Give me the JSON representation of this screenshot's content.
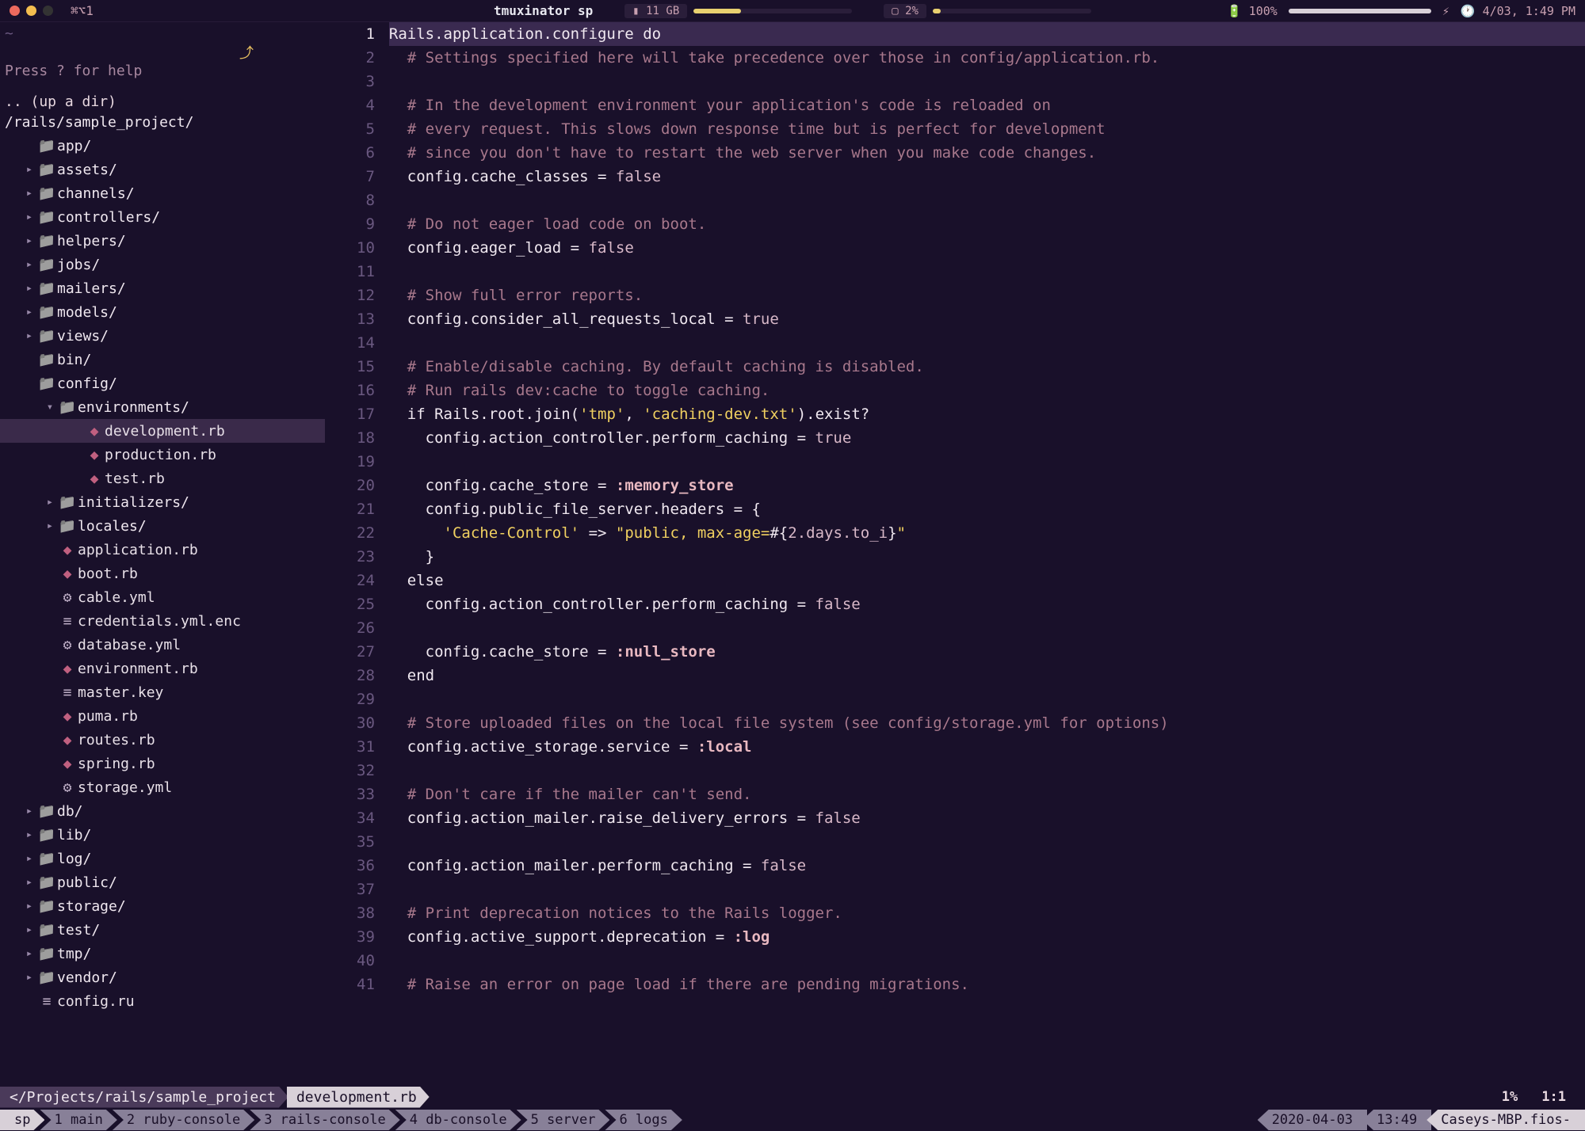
{
  "menubar": {
    "keyboard": "⌘⌥1",
    "title": "tmuxinator sp",
    "ram_label": "11 GB",
    "cpu_label": "2%",
    "battery": "100%",
    "lightning": "⚡",
    "clock_label": "4/03, 1:49 PM"
  },
  "sidebar": {
    "tilde": "~",
    "help": "Press ? for help",
    "updir": ".. (up a dir)",
    "root": "/rails/sample_project/",
    "tree": [
      {
        "indent": 1,
        "type": "folder",
        "arrow": "",
        "label": "app/"
      },
      {
        "indent": 1,
        "type": "folder",
        "arrow": "▸",
        "label": "assets/"
      },
      {
        "indent": 1,
        "type": "folder",
        "arrow": "▸",
        "label": "channels/"
      },
      {
        "indent": 1,
        "type": "folder",
        "arrow": "▸",
        "label": "controllers/"
      },
      {
        "indent": 1,
        "type": "folder",
        "arrow": "▸",
        "label": "helpers/"
      },
      {
        "indent": 1,
        "type": "folder",
        "arrow": "▸",
        "label": "jobs/"
      },
      {
        "indent": 1,
        "type": "folder",
        "arrow": "▸",
        "label": "mailers/"
      },
      {
        "indent": 1,
        "type": "folder",
        "arrow": "▸",
        "label": "models/"
      },
      {
        "indent": 1,
        "type": "folder",
        "arrow": "▸",
        "label": "views/"
      },
      {
        "indent": 1,
        "type": "folder",
        "arrow": "",
        "label": "bin/"
      },
      {
        "indent": 1,
        "type": "folder",
        "arrow": "",
        "label": "config/"
      },
      {
        "indent": 2,
        "type": "folder",
        "arrow": "▾",
        "label": "environments/"
      },
      {
        "indent": 3,
        "type": "ruby",
        "arrow": "",
        "label": "development.rb",
        "active": true
      },
      {
        "indent": 3,
        "type": "ruby",
        "arrow": "",
        "label": "production.rb"
      },
      {
        "indent": 3,
        "type": "ruby",
        "arrow": "",
        "label": "test.rb"
      },
      {
        "indent": 2,
        "type": "folder",
        "arrow": "▸",
        "label": "initializers/"
      },
      {
        "indent": 2,
        "type": "folder",
        "arrow": "▸",
        "label": "locales/"
      },
      {
        "indent": 2,
        "type": "ruby",
        "arrow": "",
        "label": "application.rb"
      },
      {
        "indent": 2,
        "type": "ruby",
        "arrow": "",
        "label": "boot.rb"
      },
      {
        "indent": 2,
        "type": "yml",
        "arrow": "",
        "label": "cable.yml"
      },
      {
        "indent": 2,
        "type": "enc",
        "arrow": "",
        "label": "credentials.yml.enc"
      },
      {
        "indent": 2,
        "type": "yml",
        "arrow": "",
        "label": "database.yml"
      },
      {
        "indent": 2,
        "type": "ruby",
        "arrow": "",
        "label": "environment.rb"
      },
      {
        "indent": 2,
        "type": "key",
        "arrow": "",
        "label": "master.key"
      },
      {
        "indent": 2,
        "type": "ruby",
        "arrow": "",
        "label": "puma.rb"
      },
      {
        "indent": 2,
        "type": "ruby",
        "arrow": "",
        "label": "routes.rb"
      },
      {
        "indent": 2,
        "type": "ruby",
        "arrow": "",
        "label": "spring.rb"
      },
      {
        "indent": 2,
        "type": "yml",
        "arrow": "",
        "label": "storage.yml"
      },
      {
        "indent": 1,
        "type": "folder",
        "arrow": "▸",
        "label": "db/"
      },
      {
        "indent": 1,
        "type": "folder",
        "arrow": "▸",
        "label": "lib/"
      },
      {
        "indent": 1,
        "type": "folder",
        "arrow": "▸",
        "label": "log/"
      },
      {
        "indent": 1,
        "type": "folder",
        "arrow": "▸",
        "label": "public/"
      },
      {
        "indent": 1,
        "type": "folder",
        "arrow": "▸",
        "label": "storage/"
      },
      {
        "indent": 1,
        "type": "folder",
        "arrow": "▸",
        "label": "test/"
      },
      {
        "indent": 1,
        "type": "folder",
        "arrow": "▸",
        "label": "tmp/"
      },
      {
        "indent": 1,
        "type": "folder",
        "arrow": "▸",
        "label": "vendor/"
      },
      {
        "indent": 1,
        "type": "enc",
        "arrow": "",
        "label": "config.ru"
      }
    ]
  },
  "editor": {
    "lines": [
      {
        "n": 1,
        "hl": true,
        "segs": [
          {
            "t": "Rails.application.configure ",
            "c": "plain"
          },
          {
            "t": "do",
            "c": "kw"
          }
        ]
      },
      {
        "n": 2,
        "segs": [
          {
            "t": "  # Settings specified here will take precedence over those in config/application.rb.",
            "c": "cmt"
          }
        ]
      },
      {
        "n": 3,
        "segs": [
          {
            "t": "",
            "c": "plain"
          }
        ]
      },
      {
        "n": 4,
        "segs": [
          {
            "t": "  # In the development environment your application's code is reloaded on",
            "c": "cmt"
          }
        ]
      },
      {
        "n": 5,
        "segs": [
          {
            "t": "  # every request. This slows down response time but is perfect for development",
            "c": "cmt"
          }
        ]
      },
      {
        "n": 6,
        "segs": [
          {
            "t": "  # since you don't have to restart the web server when you make code changes.",
            "c": "cmt"
          }
        ]
      },
      {
        "n": 7,
        "segs": [
          {
            "t": "  config.cache_classes = ",
            "c": "plain"
          },
          {
            "t": "false",
            "c": "true"
          }
        ]
      },
      {
        "n": 8,
        "segs": [
          {
            "t": "",
            "c": "plain"
          }
        ]
      },
      {
        "n": 9,
        "segs": [
          {
            "t": "  # Do not eager load code on boot.",
            "c": "cmt"
          }
        ]
      },
      {
        "n": 10,
        "segs": [
          {
            "t": "  config.eager_load = ",
            "c": "plain"
          },
          {
            "t": "false",
            "c": "true"
          }
        ]
      },
      {
        "n": 11,
        "segs": [
          {
            "t": "",
            "c": "plain"
          }
        ]
      },
      {
        "n": 12,
        "segs": [
          {
            "t": "  # Show full error reports.",
            "c": "cmt"
          }
        ]
      },
      {
        "n": 13,
        "segs": [
          {
            "t": "  config.consider_all_requests_local = ",
            "c": "plain"
          },
          {
            "t": "true",
            "c": "true"
          }
        ]
      },
      {
        "n": 14,
        "segs": [
          {
            "t": "",
            "c": "plain"
          }
        ]
      },
      {
        "n": 15,
        "segs": [
          {
            "t": "  # Enable/disable caching. By default caching is disabled.",
            "c": "cmt"
          }
        ]
      },
      {
        "n": 16,
        "segs": [
          {
            "t": "  # Run rails dev:cache to toggle caching.",
            "c": "cmt"
          }
        ]
      },
      {
        "n": 17,
        "segs": [
          {
            "t": "  if ",
            "c": "kw"
          },
          {
            "t": "Rails.root.join(",
            "c": "plain"
          },
          {
            "t": "'tmp'",
            "c": "str"
          },
          {
            "t": ", ",
            "c": "plain"
          },
          {
            "t": "'caching-dev.txt'",
            "c": "str"
          },
          {
            "t": ").exist?",
            "c": "plain"
          }
        ]
      },
      {
        "n": 18,
        "segs": [
          {
            "t": "    config.action_controller.perform_caching = ",
            "c": "plain"
          },
          {
            "t": "true",
            "c": "true"
          }
        ]
      },
      {
        "n": 19,
        "segs": [
          {
            "t": "",
            "c": "plain"
          }
        ]
      },
      {
        "n": 20,
        "segs": [
          {
            "t": "    config.cache_store = ",
            "c": "plain"
          },
          {
            "t": ":memory_store",
            "c": "sym"
          }
        ]
      },
      {
        "n": 21,
        "segs": [
          {
            "t": "    config.public_file_server.headers = {",
            "c": "plain"
          }
        ]
      },
      {
        "n": 22,
        "segs": [
          {
            "t": "      ",
            "c": "plain"
          },
          {
            "t": "'Cache-Control'",
            "c": "str"
          },
          {
            "t": " => ",
            "c": "plain"
          },
          {
            "t": "\"public, max-age=",
            "c": "str"
          },
          {
            "t": "#{",
            "c": "plain"
          },
          {
            "t": "2.days.to_i",
            "c": "true"
          },
          {
            "t": "}",
            "c": "plain"
          },
          {
            "t": "\"",
            "c": "str"
          }
        ]
      },
      {
        "n": 23,
        "segs": [
          {
            "t": "    }",
            "c": "plain"
          }
        ]
      },
      {
        "n": 24,
        "segs": [
          {
            "t": "  else",
            "c": "kw"
          }
        ]
      },
      {
        "n": 25,
        "segs": [
          {
            "t": "    config.action_controller.perform_caching = ",
            "c": "plain"
          },
          {
            "t": "false",
            "c": "true"
          }
        ]
      },
      {
        "n": 26,
        "segs": [
          {
            "t": "",
            "c": "plain"
          }
        ]
      },
      {
        "n": 27,
        "segs": [
          {
            "t": "    config.cache_store = ",
            "c": "plain"
          },
          {
            "t": ":null_store",
            "c": "sym"
          }
        ]
      },
      {
        "n": 28,
        "segs": [
          {
            "t": "  end",
            "c": "kw"
          }
        ]
      },
      {
        "n": 29,
        "segs": [
          {
            "t": "",
            "c": "plain"
          }
        ]
      },
      {
        "n": 30,
        "segs": [
          {
            "t": "  # Store uploaded files on the local file system (see config/storage.yml for options)",
            "c": "cmt"
          }
        ]
      },
      {
        "n": 31,
        "segs": [
          {
            "t": "  config.active_storage.service = ",
            "c": "plain"
          },
          {
            "t": ":local",
            "c": "sym"
          }
        ]
      },
      {
        "n": 32,
        "segs": [
          {
            "t": "",
            "c": "plain"
          }
        ]
      },
      {
        "n": 33,
        "segs": [
          {
            "t": "  # Don't care if the mailer can't send.",
            "c": "cmt"
          }
        ]
      },
      {
        "n": 34,
        "segs": [
          {
            "t": "  config.action_mailer.raise_delivery_errors = ",
            "c": "plain"
          },
          {
            "t": "false",
            "c": "true"
          }
        ]
      },
      {
        "n": 35,
        "segs": [
          {
            "t": "",
            "c": "plain"
          }
        ]
      },
      {
        "n": 36,
        "segs": [
          {
            "t": "  config.action_mailer.perform_caching = ",
            "c": "plain"
          },
          {
            "t": "false",
            "c": "true"
          }
        ]
      },
      {
        "n": 37,
        "segs": [
          {
            "t": "",
            "c": "plain"
          }
        ]
      },
      {
        "n": 38,
        "segs": [
          {
            "t": "  # Print deprecation notices to the Rails logger.",
            "c": "cmt"
          }
        ]
      },
      {
        "n": 39,
        "segs": [
          {
            "t": "  config.active_support.deprecation = ",
            "c": "plain"
          },
          {
            "t": ":log",
            "c": "sym"
          }
        ]
      },
      {
        "n": 40,
        "segs": [
          {
            "t": "",
            "c": "plain"
          }
        ]
      },
      {
        "n": 41,
        "segs": [
          {
            "t": "  # Raise an error on page load if there are pending migrations.",
            "c": "cmt"
          }
        ]
      }
    ],
    "percent": "1%",
    "position": "1:1"
  },
  "statusline": {
    "path": "</Projects/rails/sample_project",
    "file": "development.rb"
  },
  "tmux": {
    "session": "sp",
    "windows": [
      "1 main",
      "2 ruby-console",
      "3 rails-console",
      "4 db-console",
      "5 server",
      "6 logs"
    ],
    "date": "2020-04-03",
    "time": "13:49",
    "host": "Caseys-MBP.fios-"
  }
}
